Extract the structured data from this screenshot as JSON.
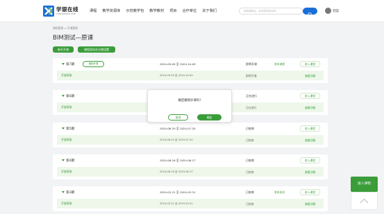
{
  "header": {
    "logo_title": "学银在线",
    "logo_sub": "xueyinonline.com",
    "nav": [
      "课程",
      "教学资源库",
      "示范教学包",
      "教学教材",
      "项目",
      "合作单位",
      "关于我们"
    ],
    "search_placeholder": "搜索课程名、老师或机构名称",
    "username": "刘志"
  },
  "breadcrumb": "课程管理 > 开课管理",
  "page_title": "BIM测试—原课",
  "actions": {
    "new_term": "新开开课",
    "batch": "课程双向交分期设置"
  },
  "terms": [
    {
      "name": "第7期",
      "tag": "撤销开课",
      "dates": "2024-09-09 至 2024-10-09",
      "status": "即将开课",
      "publish": "发布课程",
      "enter": "进入课程",
      "row": {
        "name": "开放班级",
        "dates": "2024-09-09 至 2024-10-09",
        "status": "即将开课",
        "link": "查看详情"
      }
    },
    {
      "name": "第6期",
      "tag": "",
      "dates": "",
      "status": "正在进行",
      "publish": "",
      "enter": "进入课程",
      "row": {
        "name": "开放班级",
        "dates": "",
        "status": "正在进行",
        "link": "查看详情"
      }
    },
    {
      "name": "第5期",
      "tag": "",
      "dates": "2024-06-20 至 2024-07-20",
      "status": "已结束",
      "publish": "",
      "enter": "进入课程",
      "row": {
        "name": "开放班级",
        "dates": "2024-06-20 至 2024-07-20",
        "status": "已结束",
        "link": "查看详情"
      }
    },
    {
      "name": "第4期",
      "tag": "",
      "dates": "2024-06-16 至 2024-06-17",
      "status": "已结束",
      "publish": "",
      "enter": "进入课程",
      "row": {
        "name": "开放班级",
        "dates": "2024-06-16 至 2024-06-17",
        "status": "已结束",
        "link": "查看详情"
      }
    },
    {
      "name": "第3期",
      "tag": "",
      "dates": "2024-02-21 至 2024-03-31",
      "status": "已结束",
      "publish": "发布成功",
      "enter": "进入课程",
      "row": {
        "name": "开放班级",
        "dates": "2024-02-21 至 2024-03-31",
        "status": "已结束",
        "link": "查看详情"
      }
    }
  ],
  "dialog": {
    "message": "确定撤销开课吗?",
    "cancel": "取消",
    "ok": "确定"
  },
  "float": {
    "enter": "进入课程"
  },
  "colors": {
    "primary": "#3a9d3a",
    "search": "#1a6ed8"
  }
}
